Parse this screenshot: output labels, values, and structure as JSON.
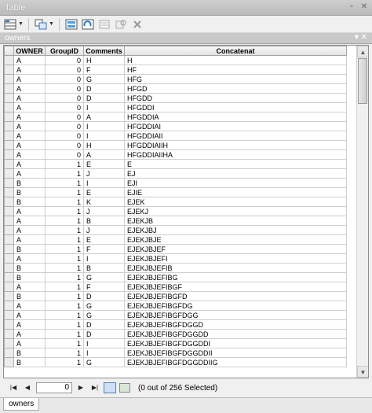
{
  "window": {
    "title": "Table"
  },
  "toolbar": {
    "icons": [
      "table-options-icon",
      "related-tables-icon",
      "select-by-attributes-icon",
      "switch-selection-icon",
      "clear-selection-icon",
      "zoom-to-selected-icon",
      "delete-selected-icon"
    ]
  },
  "table_tab": {
    "name": "owners"
  },
  "columns": [
    "OWNER",
    "GroupID",
    "Comments",
    "Concatenat"
  ],
  "rows": [
    [
      "A",
      "0",
      "H",
      "H"
    ],
    [
      "A",
      "0",
      "F",
      "HF"
    ],
    [
      "A",
      "0",
      "G",
      "HFG"
    ],
    [
      "A",
      "0",
      "D",
      "HFGD"
    ],
    [
      "A",
      "0",
      "D",
      "HFGDD"
    ],
    [
      "A",
      "0",
      "I",
      "HFGDDI"
    ],
    [
      "A",
      "0",
      "A",
      "HFGDDIA"
    ],
    [
      "A",
      "0",
      "I",
      "HFGDDIAI"
    ],
    [
      "A",
      "0",
      "I",
      "HFGDDIAII"
    ],
    [
      "A",
      "0",
      "H",
      "HFGDDIAIIH"
    ],
    [
      "A",
      "0",
      "A",
      "HFGDDIAIIHA"
    ],
    [
      "A",
      "1",
      "E",
      "E"
    ],
    [
      "A",
      "1",
      "J",
      "EJ"
    ],
    [
      "B",
      "1",
      "I",
      "EJI"
    ],
    [
      "B",
      "1",
      "E",
      "EJIE"
    ],
    [
      "B",
      "1",
      "K",
      "EJEK"
    ],
    [
      "A",
      "1",
      "J",
      "EJEKJ"
    ],
    [
      "A",
      "1",
      "B",
      "EJEKJB"
    ],
    [
      "A",
      "1",
      "J",
      "EJEKJBJ"
    ],
    [
      "A",
      "1",
      "E",
      "EJEKJBJE"
    ],
    [
      "B",
      "1",
      "F",
      "EJEKJBJEF"
    ],
    [
      "A",
      "1",
      "I",
      "EJEKJBJEFI"
    ],
    [
      "B",
      "1",
      "B",
      "EJEKJBJEFIB"
    ],
    [
      "B",
      "1",
      "G",
      "EJEKJBJEFIBG"
    ],
    [
      "A",
      "1",
      "F",
      "EJEKJBJEFIBGF"
    ],
    [
      "B",
      "1",
      "D",
      "EJEKJBJEFIBGFD"
    ],
    [
      "A",
      "1",
      "G",
      "EJEKJBJEFIBGFDG"
    ],
    [
      "A",
      "1",
      "G",
      "EJEKJBJEFIBGFDGG"
    ],
    [
      "A",
      "1",
      "D",
      "EJEKJBJEFIBGFDGGD"
    ],
    [
      "A",
      "1",
      "D",
      "EJEKJBJEFIBGFDGGDD"
    ],
    [
      "A",
      "1",
      "I",
      "EJEKJBJEFIBGFDGGDDI"
    ],
    [
      "B",
      "1",
      "I",
      "EJEKJBJEFIBGFDGGDDII"
    ],
    [
      "B",
      "1",
      "G",
      "EJEKJBJEFIBGFDGGDDIIG"
    ]
  ],
  "nav": {
    "record": "0",
    "status": "(0 out of 256 Selected)"
  },
  "bottom_tab": {
    "name": "owners"
  }
}
